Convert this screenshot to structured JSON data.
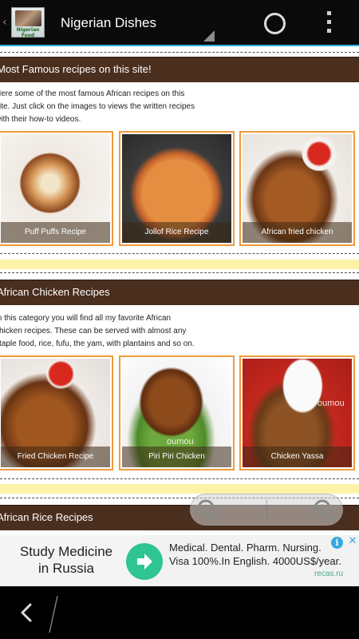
{
  "app_bar": {
    "title": "Nigerian Dishes",
    "app_icon_text": "Nigerian Food Recipes",
    "accent_color": "#33b5e5"
  },
  "sections": [
    {
      "title": "Most Famous recipes on this site!",
      "intro_lines": [
        "Here some of the most famous African recipes on this",
        "site. Just click on the images to views the written recipes",
        "with their how-to videos."
      ],
      "cards": [
        {
          "caption": "Puff Puffs Recipe",
          "icon": "puff-puff-photo"
        },
        {
          "caption": "Jollof Rice Recipe",
          "icon": "jollof-rice-photo"
        },
        {
          "caption": "African fried chicken",
          "icon": "fried-chicken-photo"
        }
      ]
    },
    {
      "title": "African Chicken Recipes",
      "intro_lines": [
        "In this category you will find all my favorite African",
        "chicken recipes. These can be served with almost any",
        "staple food, rice, fufu, the yam, with plantains and so on."
      ],
      "cards": [
        {
          "caption": "Fried Chicken Recipe",
          "icon": "fried-chicken-photo"
        },
        {
          "caption": "Piri Piri Chicken",
          "icon": "piri-piri-chicken-photo",
          "watermark": "oumou"
        },
        {
          "caption": "Chicken Yassa",
          "icon": "chicken-yassa-photo",
          "watermark": "oumou"
        }
      ]
    },
    {
      "title": "African Rice Recipes"
    }
  ],
  "ad": {
    "headline_lines": [
      "Study Medicine",
      "in Russia"
    ],
    "body_lines": [
      "Medical. Dental. Pharm. Nursing.",
      "Visa 100%.In English. 4000US$/year."
    ],
    "domain": "recas.ru",
    "info_label": "i",
    "close_label": "✕",
    "button_color": "#2fc590"
  },
  "colors": {
    "section_bar": "#4a2e1e",
    "card_border": "#f39a3c",
    "divider_band": "#fdf3a8"
  }
}
